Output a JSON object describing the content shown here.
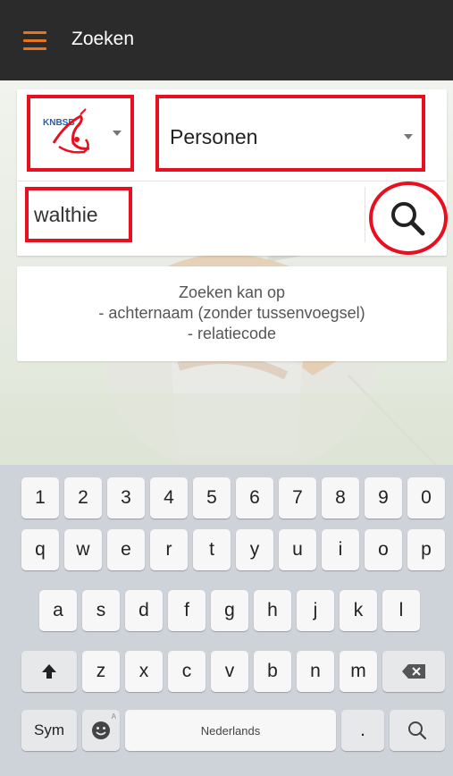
{
  "app_bar": {
    "title": "Zoeken"
  },
  "search": {
    "organization_logo_text": "KNBSB",
    "type_select": "Personen",
    "query": "walthie"
  },
  "hint": {
    "line1": "Zoeken kan op",
    "line2": "- achternaam (zonder tussenvoegsel)",
    "line3": "- relatiecode"
  },
  "keyboard": {
    "row1": [
      "1",
      "2",
      "3",
      "4",
      "5",
      "6",
      "7",
      "8",
      "9",
      "0"
    ],
    "row2": [
      "q",
      "w",
      "e",
      "r",
      "t",
      "y",
      "u",
      "i",
      "o",
      "p"
    ],
    "row3": [
      "a",
      "s",
      "d",
      "f",
      "g",
      "h",
      "j",
      "k",
      "l"
    ],
    "row4": [
      "z",
      "x",
      "c",
      "v",
      "b",
      "n",
      "m"
    ],
    "sym_label": "Sym",
    "space_label": "Nederlands",
    "period_label": ".",
    "emoji_sub": "A"
  },
  "colors": {
    "accent": "#e8741e",
    "highlight": "#e8101e",
    "appbar": "#2b2b2b"
  }
}
